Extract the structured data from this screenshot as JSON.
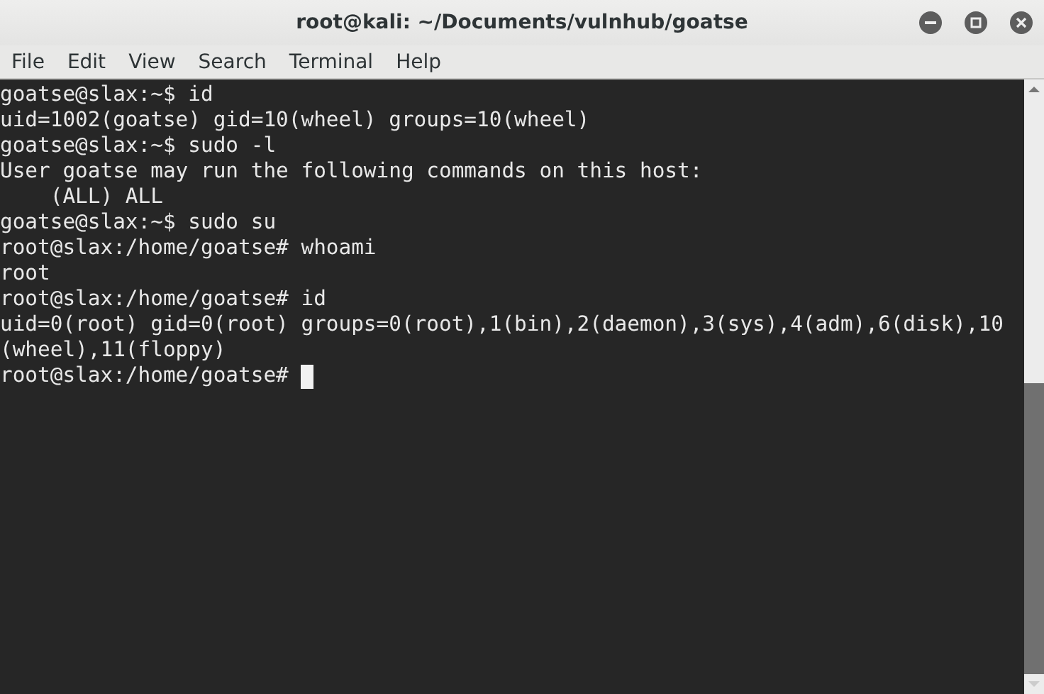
{
  "window": {
    "title": "root@kali: ~/Documents/vulnhub/goatse"
  },
  "menu": [
    "File",
    "Edit",
    "View",
    "Search",
    "Terminal",
    "Help"
  ],
  "terminal": {
    "lines": [
      "goatse@slax:~$ id",
      "uid=1002(goatse) gid=10(wheel) groups=10(wheel)",
      "goatse@slax:~$ sudo -l",
      "User goatse may run the following commands on this host:",
      "    (ALL) ALL",
      "goatse@slax:~$ sudo su",
      "root@slax:/home/goatse# whoami",
      "root",
      "root@slax:/home/goatse# id",
      "uid=0(root) gid=0(root) groups=0(root),1(bin),2(daemon),3(sys),4(adm),6(disk),10",
      "(wheel),11(floppy)"
    ],
    "prompt": "root@slax:/home/goatse# "
  }
}
